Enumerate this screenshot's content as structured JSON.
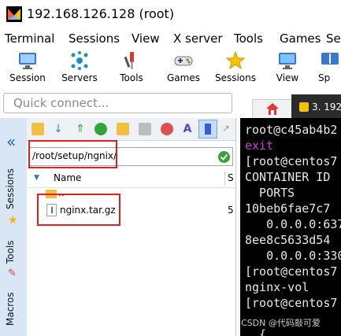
{
  "window": {
    "title": "192.168.126.128 (root)"
  },
  "menu": [
    "Terminal",
    "Sessions",
    "View",
    "X server",
    "Tools",
    "Games",
    "Se"
  ],
  "toolbar": [
    "Session",
    "Servers",
    "Tools",
    "Games",
    "Sessions",
    "View",
    "Sp"
  ],
  "quick_connect": {
    "placeholder": "Quick connect..."
  },
  "side_tabs": [
    "Sessions",
    "Tools",
    "Macros"
  ],
  "file_browser": {
    "path": "/root/setup/ngnix/",
    "columns": {
      "name": "Name",
      "size": "S"
    },
    "rows": [
      {
        "name": "..",
        "size": ""
      },
      {
        "name": "nginx.tar.gz",
        "size": "5"
      }
    ]
  },
  "terminal": {
    "tab_label": "3. 192",
    "lines": [
      "root@c45ab4b2",
      "exit",
      "[root@centos7",
      "CONTAINER ID",
      "  PORTS",
      "10beb6fae7c7",
      "   0.0.0.0:637",
      "8ee8c5633d54",
      "   0.0.0.0:330",
      "[root@centos7",
      "nginx-vol",
      "[root@centos7",
      "  {"
    ]
  },
  "watermark": "CSDN @代码敲可爱"
}
